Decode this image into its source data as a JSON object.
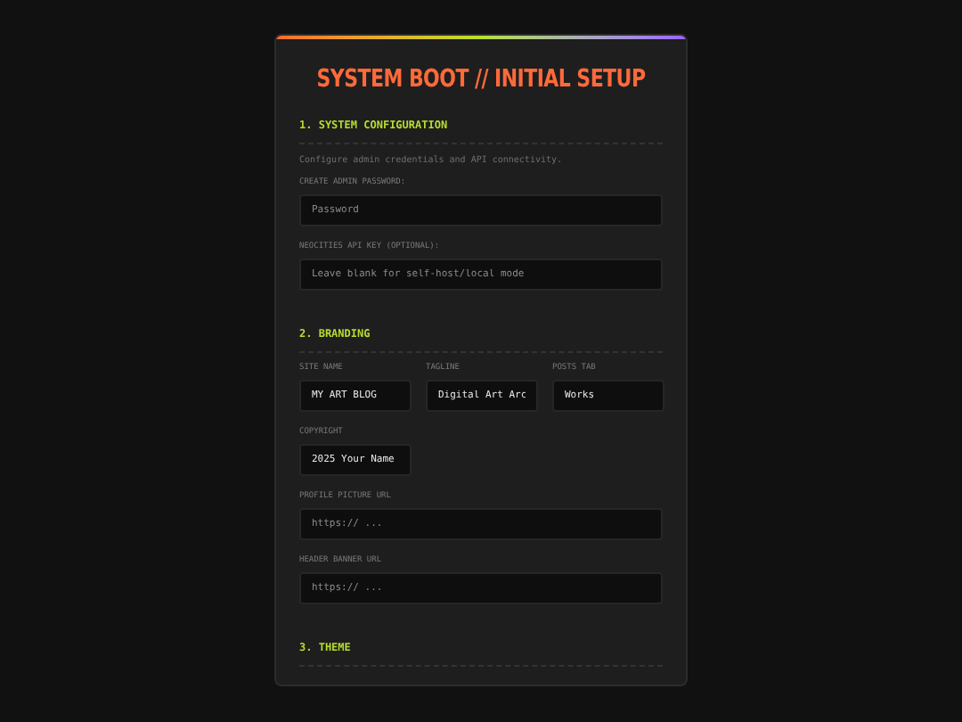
{
  "title": "SYSTEM BOOT // INITIAL SETUP",
  "sections": [
    {
      "heading": "1. SYSTEM CONFIGURATION",
      "description": "Configure admin credentials and API connectivity.",
      "rows": [
        [
          {
            "label": "CREATE ADMIN PASSWORD:",
            "placeholder": "Password"
          }
        ],
        [
          {
            "label": "NEOCITIES API KEY (OPTIONAL):",
            "placeholder": "Leave blank for self-host/local mode"
          }
        ]
      ]
    },
    {
      "heading": "2. BRANDING",
      "rows": [
        [
          {
            "label": "SITE NAME",
            "value": "MY ART BLOG"
          },
          {
            "label": "TAGLINE",
            "value": "Digital Art Arc"
          },
          {
            "label": "POSTS TAB",
            "value": "Works"
          }
        ],
        [
          {
            "label": "COPYRIGHT",
            "value": "2025 Your Name"
          }
        ],
        [
          {
            "label": "PROFILE PICTURE URL",
            "placeholder": "https:// ..."
          }
        ],
        [
          {
            "label": "HEADER BANNER URL",
            "placeholder": "https:// ..."
          }
        ]
      ]
    },
    {
      "heading": "3. THEME"
    }
  ]
}
